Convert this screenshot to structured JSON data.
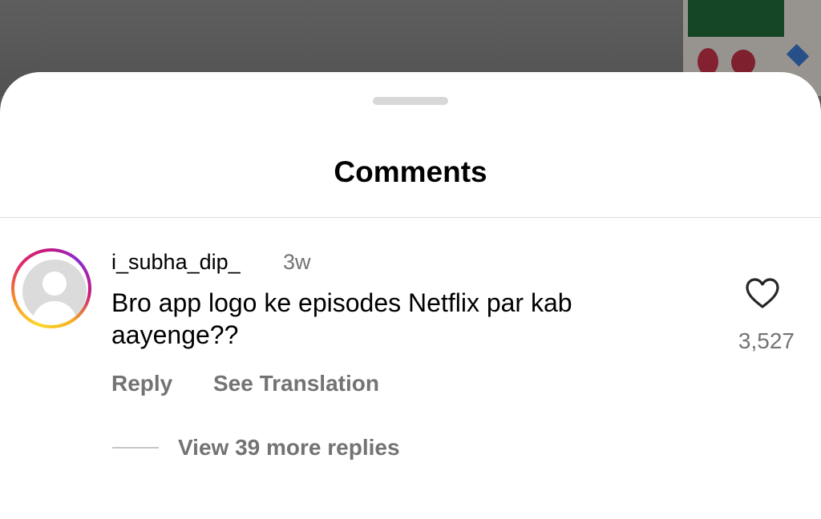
{
  "sheet": {
    "title": "Comments"
  },
  "comment": {
    "username": "i_subha_dip_",
    "time": "3w",
    "text": "Bro app logo ke episodes Netflix par kab aayenge??",
    "likes": "3,527",
    "reply_label": "Reply",
    "translate_label": "See Translation",
    "view_replies_label": "View 39 more replies"
  },
  "icons": {
    "like": "heart-outline-icon",
    "avatar": "default-avatar-icon"
  },
  "colors": {
    "text_primary": "#000000",
    "text_secondary": "#737373",
    "story_ring_start": "#fdd82c",
    "story_ring_end": "#c4197f"
  }
}
